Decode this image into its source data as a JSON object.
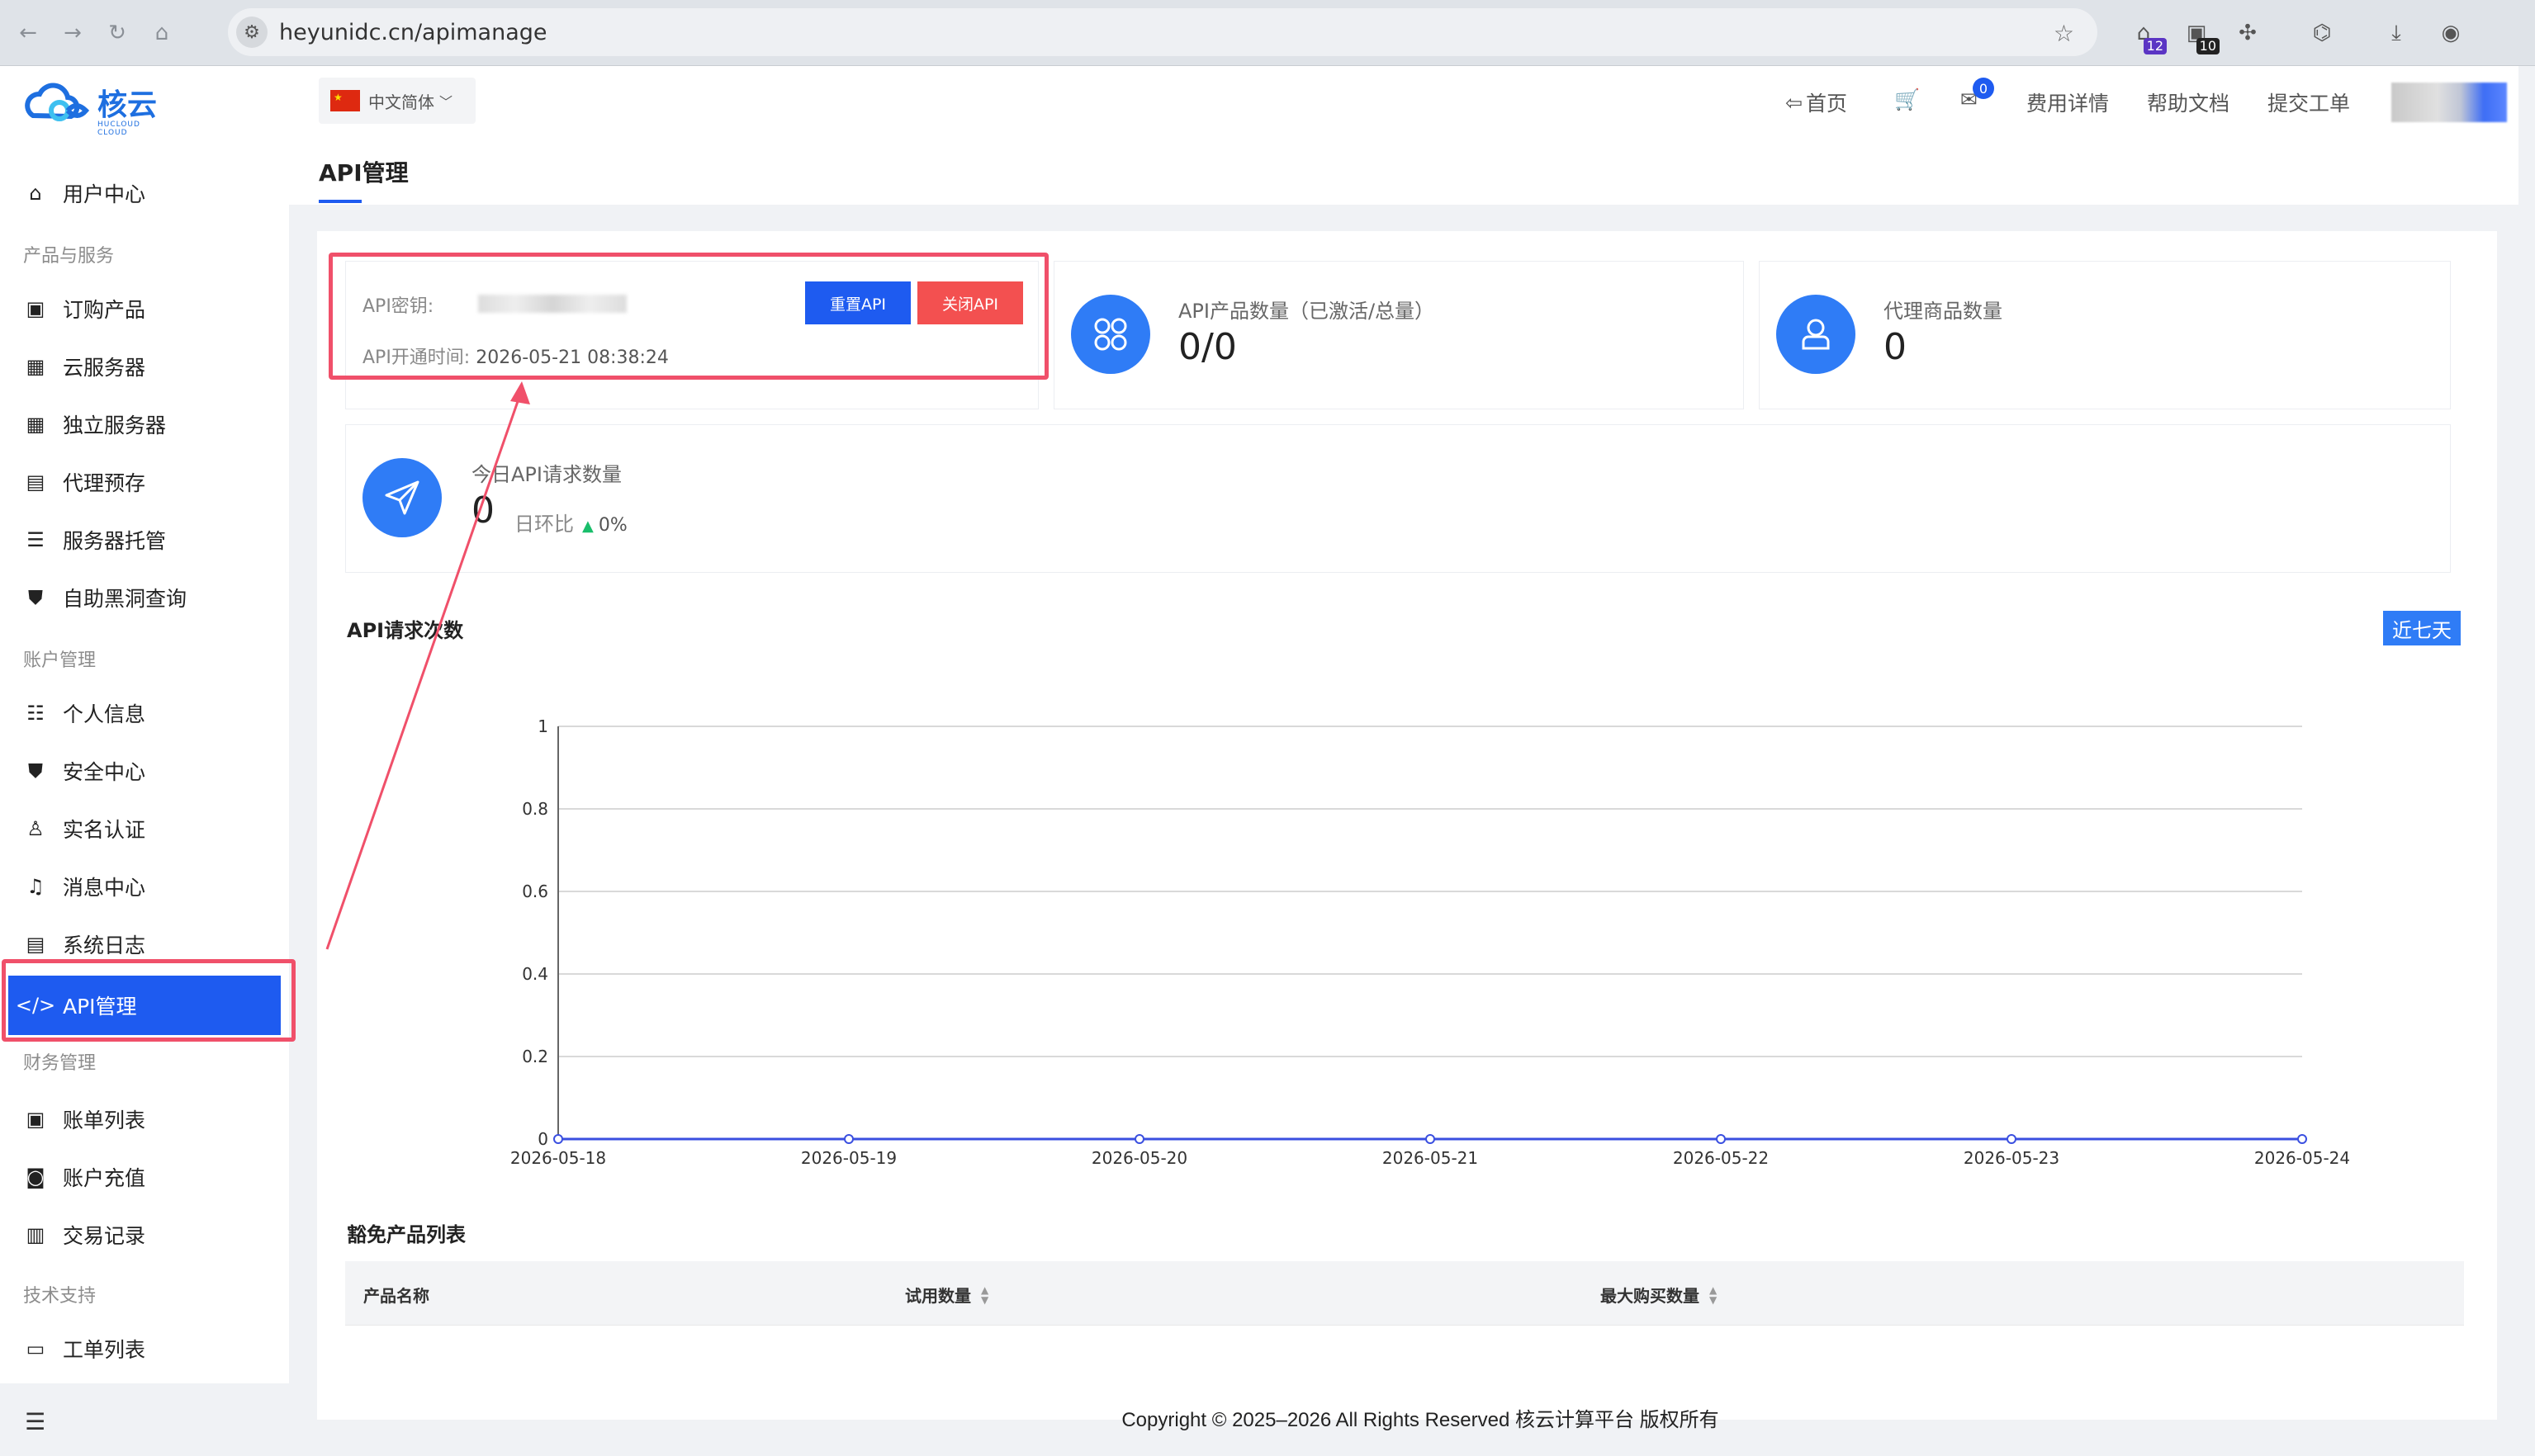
{
  "browser": {
    "url": "heyunidc.cn/apimanage",
    "ext_badge_1": "12",
    "ext_badge_2": "10"
  },
  "logo": {
    "name": "核云",
    "tagline": "HUCLOUD CLOUD"
  },
  "sidebar": {
    "user_center": "用户中心",
    "group_products": "产品与服务",
    "products": [
      "订购产品",
      "云服务器",
      "独立服务器",
      "代理预存",
      "服务器托管",
      "自助黑洞查询"
    ],
    "group_account": "账户管理",
    "account": [
      "个人信息",
      "安全中心",
      "实名认证",
      "消息中心",
      "系统日志",
      "API管理"
    ],
    "group_finance": "财务管理",
    "finance": [
      "账单列表",
      "账户充值",
      "交易记录"
    ],
    "group_support": "技术支持",
    "support": [
      "工单列表"
    ]
  },
  "topbar": {
    "language": "中文简体",
    "home": "首页",
    "mail_count": "0",
    "billing": "费用详情",
    "help": "帮助文档",
    "ticket": "提交工单"
  },
  "page": {
    "title": "API管理"
  },
  "api_key_card": {
    "key_label": "API密钥:",
    "time_label": "API开通时间:",
    "time_value": "2026-05-21 08:38:24",
    "reset_button": "重置API",
    "close_button": "关闭API"
  },
  "stats": {
    "products_label": "API产品数量（已激活/总量）",
    "products_value": "0/0",
    "agent_label": "代理商品数量",
    "agent_value": "0",
    "today_label": "今日API请求数量",
    "today_value": "0",
    "ratio_label": "日环比",
    "ratio_value": "0%"
  },
  "chart_section": {
    "title": "API请求次数",
    "range_button": "近七天"
  },
  "chart_data": {
    "type": "line",
    "x": [
      "2026-05-18",
      "2026-05-19",
      "2026-05-20",
      "2026-05-21",
      "2026-05-22",
      "2026-05-23",
      "2026-05-24"
    ],
    "series": [
      {
        "values": [
          0,
          0,
          0,
          0,
          0,
          0,
          0
        ]
      }
    ],
    "ylim": [
      0,
      1
    ],
    "yticks": [
      "0",
      "0.2",
      "0.4",
      "0.6",
      "0.8",
      "1"
    ],
    "line_color": "#3a4fe0",
    "grid": true
  },
  "table": {
    "title": "豁免产品列表",
    "columns": [
      "产品名称",
      "试用数量",
      "最大购买数量"
    ]
  },
  "footer": {
    "copyright": "Copyright © 2025–2026 All Rights Reserved 核云计算平台 版权所有"
  }
}
